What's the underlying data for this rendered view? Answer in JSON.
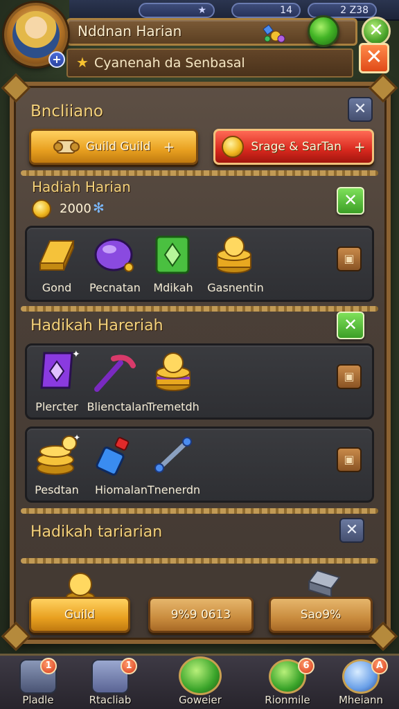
{
  "hud": {
    "left_value": "",
    "mid_value": "14",
    "right_value": "2 Z38"
  },
  "header": {
    "title": "Nddnan Harian",
    "subtitle": "Cyanenah da Senbasal"
  },
  "panel": {
    "title": "Bncliiano",
    "guild_button": "Guild Guild",
    "stage_button": "Srage & SarTan",
    "plus": "+"
  },
  "section1": {
    "title": "Hadiah Harian",
    "amount": "2000",
    "items": [
      {
        "label": "Gond",
        "icon": "gold-bar-icon"
      },
      {
        "label": "Pecnatan",
        "icon": "purple-orb-icon"
      },
      {
        "label": "Mdikah",
        "icon": "green-gem-card-icon"
      },
      {
        "label": "Gasnentin",
        "icon": "coin-stack-icon"
      }
    ]
  },
  "section2": {
    "title": "Hadikah Hareriah",
    "row1": [
      {
        "label": "Plercter",
        "icon": "purple-crystal-card-icon"
      },
      {
        "label": "Blienctalan",
        "icon": "pickaxe-icon"
      },
      {
        "label": "Tremetdh",
        "icon": "coin-stack-icon"
      }
    ],
    "row2": [
      {
        "label": "Pesdtan",
        "icon": "coin-pile-icon"
      },
      {
        "label": "Hiomalan",
        "icon": "potion-bottle-icon"
      },
      {
        "label": "Tnenerdn",
        "icon": "wrench-icon"
      }
    ]
  },
  "section3": {
    "title": "Hadikah tariarian"
  },
  "footer_buttons": {
    "guild": "Guild",
    "center": "9%9 0613",
    "right": "Sao9%"
  },
  "bottom_nav": [
    {
      "label": "Pladle",
      "badge": "1"
    },
    {
      "label": "Rtacliab",
      "badge": "1"
    },
    {
      "label": "Goweier",
      "badge": ""
    },
    {
      "label": "Rionmile",
      "badge": "6"
    },
    {
      "label": "Mheiann",
      "badge": "A"
    }
  ],
  "colors": {
    "gold_button": "#e8a020",
    "red_button": "#d8281e",
    "green_check": "#3c9f26",
    "wood_frame": "#8b6232",
    "section_title": "#f3d27c"
  }
}
